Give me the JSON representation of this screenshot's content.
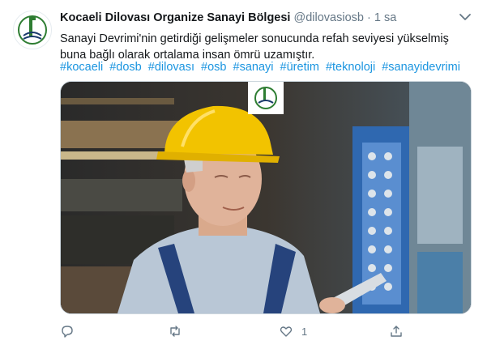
{
  "tweet": {
    "author_name": "Kocaeli Dilovası Organize Sanayi Bölgesi",
    "handle": "@dilovasiosb",
    "separator": "·",
    "time": "1 sa",
    "text": "Sanayi Devrimi'nin getirdiği gelişmeler sonucunda refah seviyesi yükselmiş buna bağlı olarak ortalama insan ömrü uzamıştır.",
    "hashtags": [
      "#kocaeli",
      "#dosb",
      "#dilovası",
      "#osb",
      "#sanayi",
      "#üretim",
      "#teknoloji",
      "#sanayidevrimi"
    ],
    "likes": "1"
  },
  "colors": {
    "link": "#1b95e0",
    "muted": "#657786",
    "helmet": "#f2c300",
    "overall": "#2b4a8a"
  },
  "icons": {
    "menu": "chevron-down-icon",
    "reply": "reply-icon",
    "retweet": "retweet-icon",
    "like": "heart-icon",
    "share": "share-icon",
    "logo": "osb-logo-icon"
  }
}
